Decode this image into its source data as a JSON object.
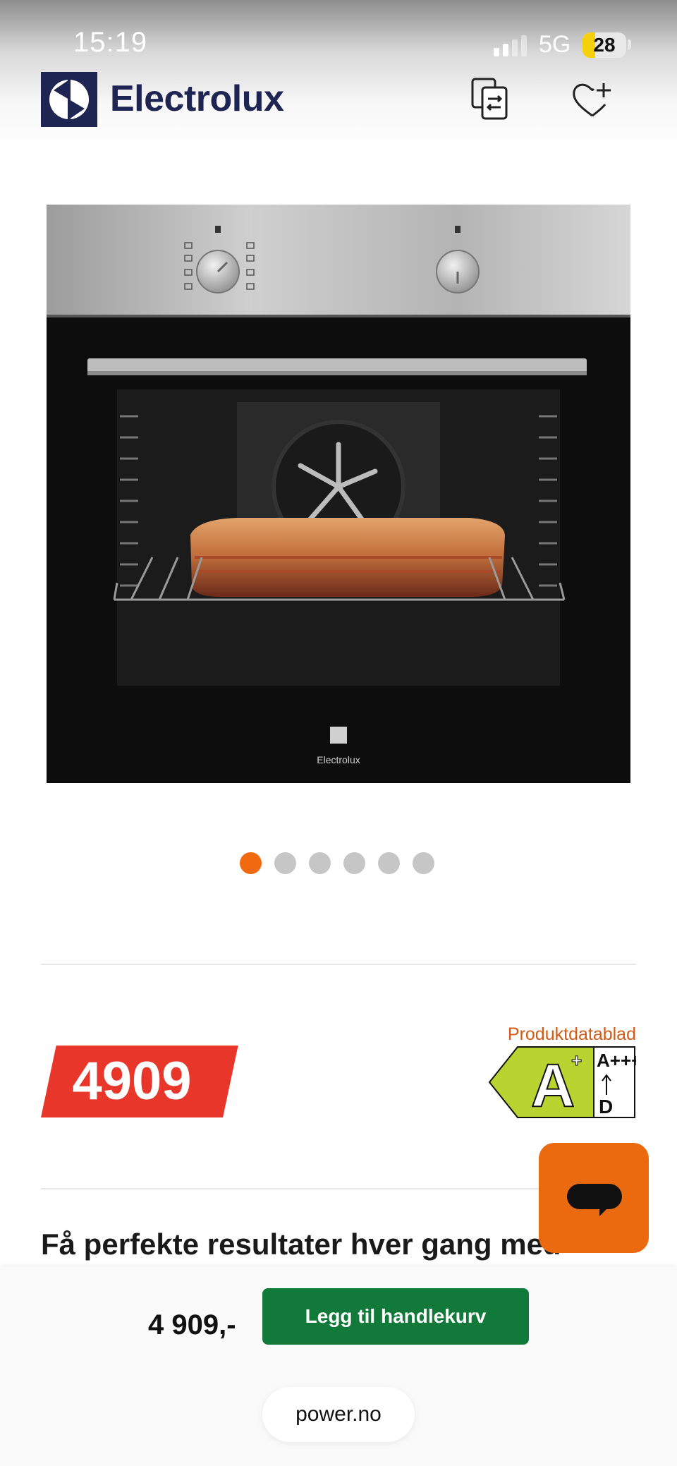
{
  "status_bar": {
    "time": "15:19",
    "network": "5G",
    "battery": "28"
  },
  "header": {
    "brand": "Electrolux",
    "icons": {
      "logo": "electrolux-logo-icon",
      "compare": "compare-icon",
      "wishlist": "heart-plus-icon"
    }
  },
  "product": {
    "image_icon": "oven-product-image",
    "image_brand": "Electrolux",
    "carousel": {
      "total": 6,
      "active": 1
    }
  },
  "price": {
    "tag": "4909",
    "bottom": "4 909,-"
  },
  "energy": {
    "link": "Produktdatablad",
    "rating": "A",
    "rating_sup": "+",
    "scale_top": "A+++",
    "scale_bottom": "D",
    "color": "#b9d431"
  },
  "description": {
    "heading": "Få perfekte resultater hver gang med"
  },
  "actions": {
    "add_to_cart": "Legg til handlekurv"
  },
  "browser": {
    "url": "power.no"
  },
  "colors": {
    "accent": "#f26a10",
    "price": "#e8372a",
    "cart": "#117a3a",
    "brand": "#1e2552"
  }
}
